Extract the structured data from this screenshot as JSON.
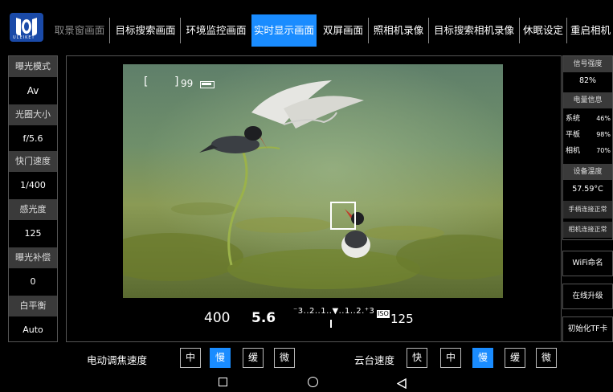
{
  "logo_text": "ULEIKET",
  "tabs": [
    {
      "label": "取景窗画面",
      "state": "dim"
    },
    {
      "label": "目标搜索画面",
      "state": "normal"
    },
    {
      "label": "环境监控画面",
      "state": "normal"
    },
    {
      "label": "实时显示画面",
      "state": "active"
    },
    {
      "label": "双屏画面",
      "state": "normal"
    },
    {
      "label": "照相机录像",
      "state": "normal"
    },
    {
      "label": "目标搜索相机录像",
      "state": "normal"
    },
    {
      "label": "休眠设定",
      "state": "normal"
    },
    {
      "label": "重启相机",
      "state": "normal"
    }
  ],
  "left_panel": {
    "exposure_mode_label": "曝光模式",
    "exposure_mode_value": "Av",
    "aperture_label": "光圈大小",
    "aperture_value": "f/5.6",
    "shutter_label": "快门速度",
    "shutter_value": "1/400",
    "iso_label": "感光度",
    "iso_value": "125",
    "ev_label": "曝光补偿",
    "ev_value": "0",
    "wb_label": "白平衡",
    "wb_value": "Auto"
  },
  "right_panel": {
    "signal_label": "信号强度",
    "signal_value": "82%",
    "battery_label": "电量信息",
    "battery_rows": [
      {
        "name": "系统",
        "value": "46%"
      },
      {
        "name": "平板",
        "value": "98%"
      },
      {
        "name": "相机",
        "value": "70%"
      }
    ],
    "temp_label": "设备温度",
    "temp_value": "57.59°C",
    "handle_status": "手柄连接正常",
    "camera_status": "相机连接正常",
    "wifi_button": "WiFi命名",
    "upgrade_button": "在线升级",
    "format_button": "初始化TF卡"
  },
  "overlay": {
    "shots_left": "99",
    "bracket_left": "[",
    "bracket_right": "]"
  },
  "readout": {
    "shutter": "400",
    "aperture": "5.6",
    "scale": "⁻3..2..1..▼..1..2.⁺3",
    "iso_badge": "ISO",
    "iso": "125"
  },
  "focus_speed": {
    "label": "电动调焦速度",
    "options": [
      "中",
      "慢",
      "缓",
      "微"
    ],
    "selected": "慢"
  },
  "gimbal_speed": {
    "label": "云台速度",
    "options": [
      "快",
      "中",
      "慢",
      "缓",
      "微"
    ],
    "selected": "慢"
  },
  "colors": {
    "accent": "#1a8cff",
    "panel_label_bg": "#3a3a3a",
    "border": "#555555"
  },
  "nav_icons": [
    "recents-square-icon",
    "home-circle-icon",
    "back-triangle-icon"
  ]
}
